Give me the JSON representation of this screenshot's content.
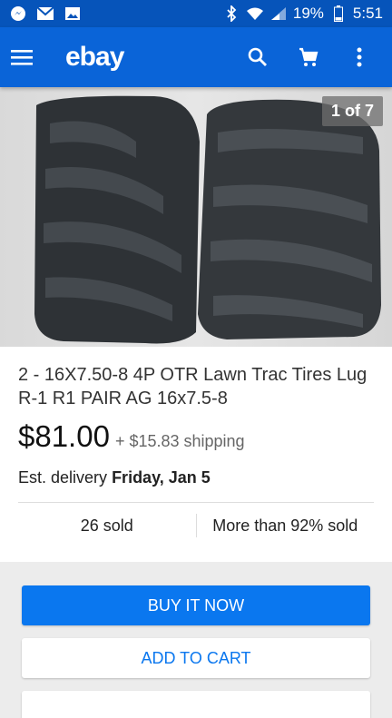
{
  "status_bar": {
    "battery_percent": "19%",
    "time": "5:51"
  },
  "app_bar": {
    "logo": "ebay"
  },
  "gallery": {
    "counter": "1 of 7"
  },
  "item": {
    "title": "2 - 16X7.50-8 4P OTR Lawn Trac Tires Lug R-1 R1 PAIR AG 16x7.5-8",
    "price": "$81.00",
    "shipping": "+ $15.83 shipping",
    "delivery_label": "Est. delivery",
    "delivery_date": "Friday, Jan 5",
    "sold_count": "26 sold",
    "sold_percent": "More than 92% sold"
  },
  "buttons": {
    "buy_now": "BUY IT NOW",
    "add_to_cart": "ADD TO CART"
  },
  "colors": {
    "status_bar": "#0654ba",
    "app_bar": "#0a64d8",
    "primary_button": "#0a77ef"
  },
  "icons": [
    "facebook-messenger-icon",
    "gmail-icon",
    "gallery-icon",
    "bluetooth-icon",
    "wifi-icon",
    "signal-icon",
    "battery-icon",
    "menu-icon",
    "search-icon",
    "cart-icon",
    "more-vert-icon"
  ]
}
